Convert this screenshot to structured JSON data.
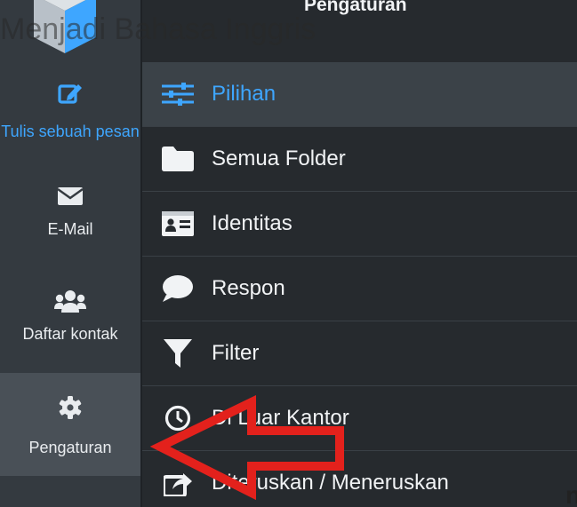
{
  "overlay": {
    "caption": "Menjadi Bahasa Inggris",
    "stray_char": "n",
    "arrow_color": "#e3211c"
  },
  "sidebar": {
    "items": [
      {
        "label": "Tulis sebuah pesan",
        "icon": "compose-icon",
        "active": false
      },
      {
        "label": "E-Mail",
        "icon": "envelope-icon",
        "active": false
      },
      {
        "label": "Daftar kontak",
        "icon": "users-icon",
        "active": false
      },
      {
        "label": "Pengaturan",
        "icon": "gear-icon",
        "active": true
      }
    ]
  },
  "panel": {
    "title": "Pengaturan",
    "menu": [
      {
        "label": "Pilihan",
        "icon": "sliders-icon",
        "active": true
      },
      {
        "label": "Semua Folder",
        "icon": "folder-icon",
        "active": false
      },
      {
        "label": "Identitas",
        "icon": "id-card-icon",
        "active": false
      },
      {
        "label": "Respon",
        "icon": "comment-icon",
        "active": false
      },
      {
        "label": "Filter",
        "icon": "filter-icon",
        "active": false
      },
      {
        "label": "Di Luar Kantor",
        "icon": "clock-icon",
        "active": false
      },
      {
        "label": "Diteruskan / Meneruskan",
        "icon": "forward-icon",
        "active": false
      }
    ]
  },
  "colors": {
    "sidebar_bg": "#343a40",
    "panel_bg": "#262a2e",
    "active_bg": "#3b4248",
    "accent": "#3ea6ff",
    "text": "#f1f3f5"
  }
}
